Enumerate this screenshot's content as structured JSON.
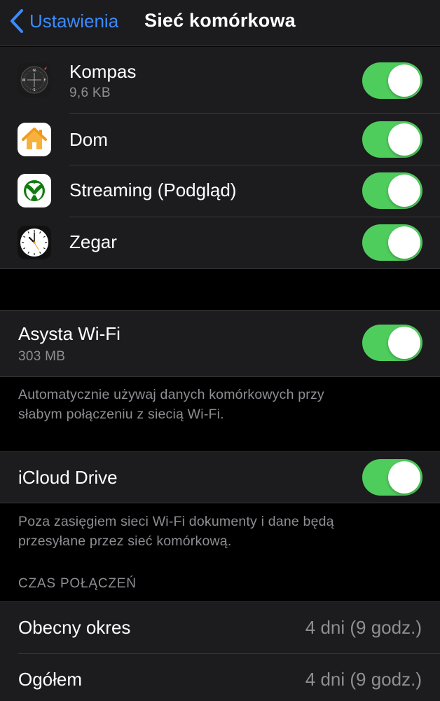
{
  "navbar": {
    "back_label": "Ustawienia",
    "title": "Sieć komórkowa"
  },
  "apps": [
    {
      "name": "Kompas",
      "usage": "9,6 KB",
      "icon": "compass-icon",
      "enabled": true
    },
    {
      "name": "Dom",
      "icon": "home-icon",
      "enabled": true
    },
    {
      "name": "Streaming (Podgląd)",
      "icon": "xbox-icon",
      "enabled": true
    },
    {
      "name": "Zegar",
      "icon": "clock-icon",
      "enabled": true
    }
  ],
  "wifi_assist": {
    "label": "Asysta Wi-Fi",
    "usage": "303 MB",
    "enabled": true,
    "footer_line1": "Automatycznie używaj danych komórkowych przy",
    "footer_line2": "słabym połączeniu z siecią Wi-Fi."
  },
  "icloud_drive": {
    "label": "iCloud Drive",
    "enabled": true,
    "footer_line1": "Poza zasięgiem sieci Wi-Fi dokumenty i dane będą",
    "footer_line2": "przesyłane przez sieć komórkową."
  },
  "call_time": {
    "header": "CZAS POŁĄCZEŃ",
    "rows": [
      {
        "label": "Obecny okres",
        "value": "4 dni (9 godz.)"
      },
      {
        "label": "Ogółem",
        "value": "4 dni (9 godz.)"
      }
    ]
  },
  "colors": {
    "accent": "#3a8bff",
    "toggle_on": "#4fcd5c",
    "cell_bg": "#1c1c1e",
    "separator": "#38383a",
    "secondary_text": "#8e8e93"
  }
}
